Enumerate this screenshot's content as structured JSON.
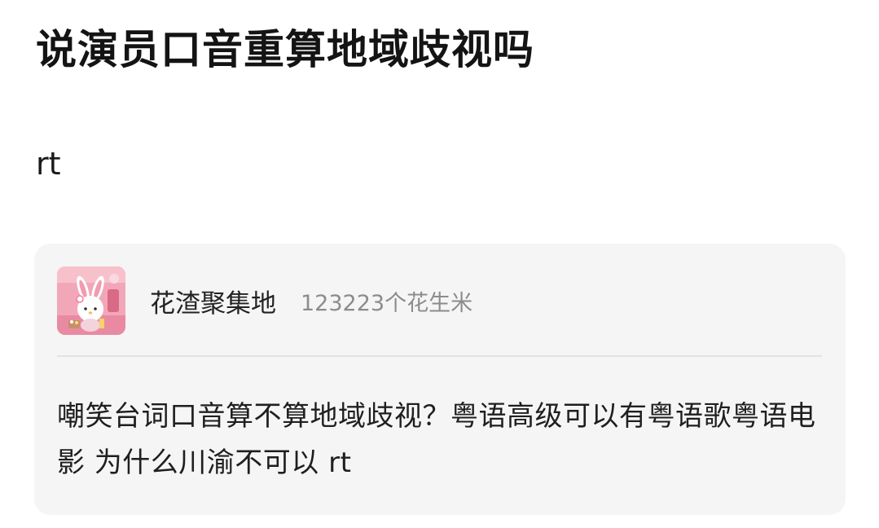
{
  "post": {
    "title": "说演员口音重算地域歧视吗",
    "body": "rt"
  },
  "quoted_card": {
    "avatar_icon": "melody-bunny-avatar",
    "group_name": "花渣聚集地",
    "member_count": "123223个花生米",
    "text": "嘲笑台词口音算不算地域歧视？粤语高级可以有粤语歌粤语电影 为什么川渝不可以 rt"
  },
  "colors": {
    "card_background": "#f5f5f5",
    "muted_text": "#8c8c8c",
    "divider": "#e3e3e3"
  }
}
